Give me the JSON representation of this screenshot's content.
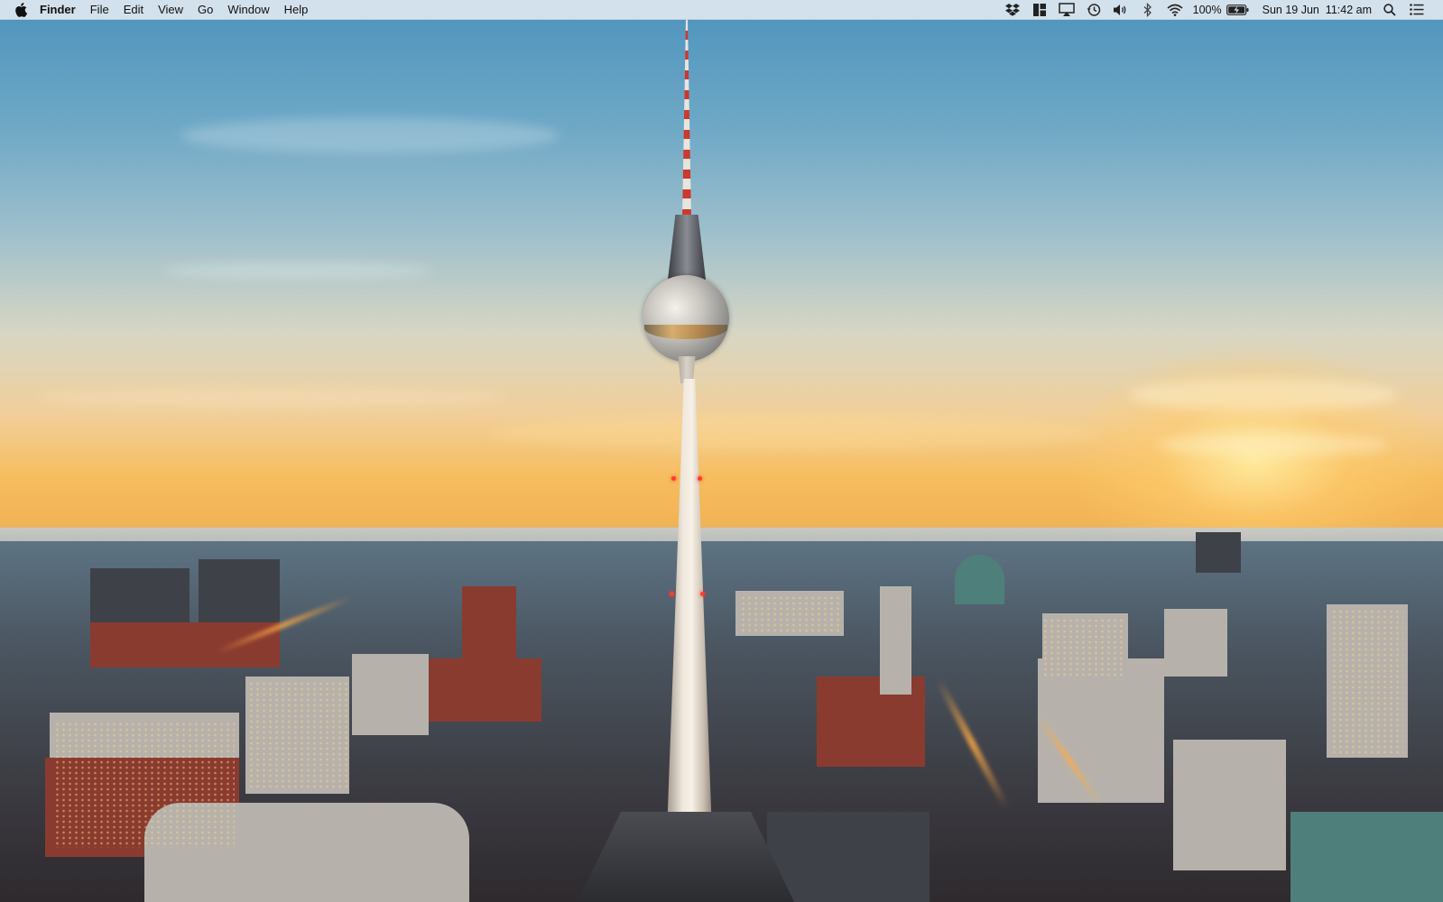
{
  "menubar": {
    "apple_icon": "apple-icon",
    "app_name": "Finder",
    "menus": [
      "File",
      "Edit",
      "View",
      "Go",
      "Window",
      "Help"
    ],
    "status_icons": [
      "dropbox-icon",
      "window-layout-icon",
      "airplay-icon",
      "time-machine-icon",
      "volume-icon",
      "bluetooth-icon",
      "wifi-icon"
    ],
    "battery_percent": "100%",
    "battery_icon": "battery-charging-icon",
    "clock": "Sun 19 Jun  11:42 am",
    "spotlight_icon": "spotlight-search-icon",
    "notification_icon": "notification-center-icon"
  },
  "desktop": {
    "wallpaper": "Berlin TV tower skyline at sunset",
    "colors": {
      "sky_top": "#4d93bd",
      "horizon": "#f6bd5e",
      "tower_light": "#ff3b30"
    }
  }
}
